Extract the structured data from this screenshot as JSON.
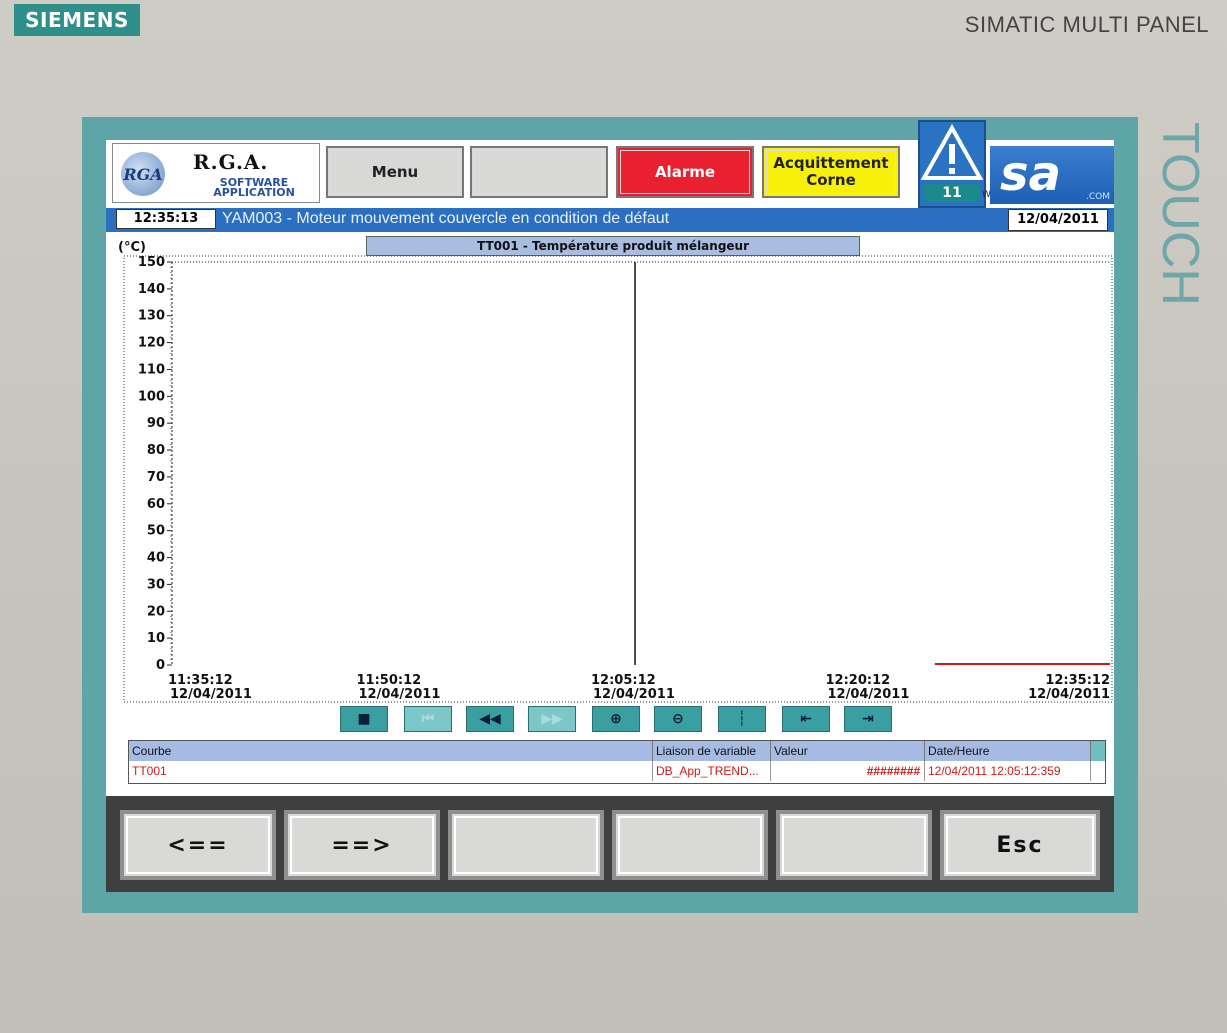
{
  "device": {
    "brand": "SIEMENS",
    "model": "SIMATIC MULTI PANEL",
    "side_label": "TOUCH"
  },
  "header": {
    "logo_initials": "RGA",
    "logo_title": "R.G.A.",
    "logo_sub1": "SOFTWARE",
    "logo_sub2": "APPLICATION",
    "menu_label": "Menu",
    "blank_label": "",
    "alarm_label": "Alarme",
    "ack_label_1": "Acquittement",
    "ack_label_2": "Corne",
    "warning_count": "11",
    "brand_text": "sa",
    "brand_com": ".COM",
    "brand_w": "W"
  },
  "status": {
    "time": "12:35:13",
    "message": "YAM003 - Moteur mouvement couvercle en condition de défaut",
    "date": "12/04/2011"
  },
  "chart_data": {
    "type": "line",
    "title": "TT001 - Température produit mélangeur",
    "ylabel": "(°C)",
    "ylim": [
      0,
      150
    ],
    "y_ticks": [
      0,
      10,
      20,
      30,
      40,
      50,
      60,
      70,
      80,
      90,
      100,
      110,
      120,
      130,
      140,
      150
    ],
    "x_ticks": [
      {
        "time": "11:35:12",
        "date": "12/04/2011"
      },
      {
        "time": "11:50:12",
        "date": "12/04/2011"
      },
      {
        "time": "12:05:12",
        "date": "12/04/2011"
      },
      {
        "time": "12:20:12",
        "date": "12/04/2011"
      },
      {
        "time": "12:35:12",
        "date": "12/04/2011"
      }
    ],
    "cursor_time": "12:05:12",
    "series": [
      {
        "name": "TT001",
        "color": "#d21818",
        "points": [
          [
            "12:24:00",
            0
          ],
          [
            "12:35:12",
            0
          ]
        ]
      }
    ]
  },
  "toolbar": [
    {
      "icon": "stop-icon",
      "glyph": "■",
      "enabled": true
    },
    {
      "icon": "first-icon",
      "glyph": "⏮",
      "enabled": false
    },
    {
      "icon": "rewind-icon",
      "glyph": "◀◀",
      "enabled": true
    },
    {
      "icon": "forward-icon",
      "glyph": "▶▶",
      "enabled": false
    },
    {
      "icon": "zoom-in-icon",
      "glyph": "⊕",
      "enabled": true
    },
    {
      "icon": "zoom-out-icon",
      "glyph": "⊖",
      "enabled": true
    },
    {
      "icon": "ruler-icon",
      "glyph": "┆",
      "enabled": true
    },
    {
      "icon": "ruler-back-icon",
      "glyph": "⇤",
      "enabled": true
    },
    {
      "icon": "ruler-forward-icon",
      "glyph": "⇥",
      "enabled": true
    }
  ],
  "table": {
    "headers": {
      "curve": "Courbe",
      "link": "Liaison de variable",
      "value": "Valeur",
      "datetime": "Date/Heure"
    },
    "row": {
      "curve": "TT001",
      "link": "DB_App_TREND...",
      "value": "########",
      "datetime": "12/04/2011 12:05:12:359"
    }
  },
  "fkeys": [
    "<==",
    "==>",
    "",
    "",
    "",
    "Esc"
  ]
}
